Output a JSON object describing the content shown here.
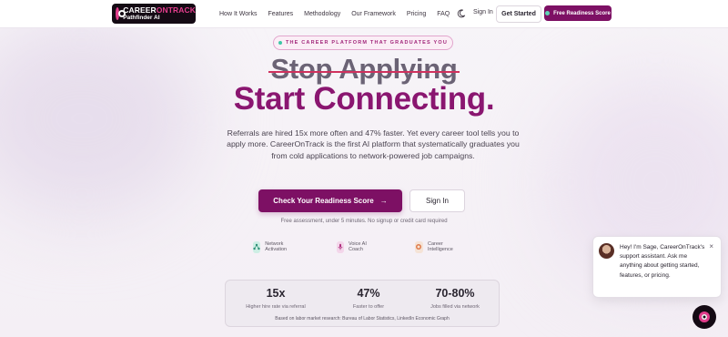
{
  "nav": {
    "logo_line1_a": "CAREER",
    "logo_line1_b": "ONTRACK",
    "logo_line2": "Pathfinder AI",
    "links": [
      "How It Works",
      "Features",
      "Methodology",
      "Our Framework",
      "Pricing",
      "FAQ"
    ],
    "signin": "Sign In",
    "get_started": "Get Started",
    "free_score": "Free Readiness Score"
  },
  "hero": {
    "badge": "THE CAREER PLATFORM THAT GRADUATES YOU",
    "strike_headline": "Stop Applying",
    "headline": "Start Connecting.",
    "subtitle": "Referrals are hired 15x more often and 47% faster. Yet every career tool tells you to apply more. CareerOnTrack is the first AI platform that systematically graduates you from cold applications to network-powered job campaigns.",
    "cta_primary": "Check Your Readiness Score",
    "cta_primary_arrow": "→",
    "cta_secondary": "Sign In",
    "note": "Free assessment, under 5 minutes. No signup or credit card required"
  },
  "features": [
    {
      "label": "Network Activation",
      "icon": "network-icon",
      "color": "#cdeee4"
    },
    {
      "label": "Voice AI Coach",
      "icon": "microphone-icon",
      "color": "#f3d6ea"
    },
    {
      "label": "Career Intelligence",
      "icon": "target-icon",
      "color": "#f5e3d6"
    }
  ],
  "stats": {
    "items": [
      {
        "value": "15x",
        "label": "Higher hire rate via referral"
      },
      {
        "value": "47%",
        "label": "Faster to offer"
      },
      {
        "value": "70-80%",
        "label": "Jobs filled via network"
      }
    ],
    "source": "Based on labor market research: Bureau of Labor Statistics, LinkedIn Economic Graph"
  },
  "chat": {
    "message": "Hey! I'm Sage, CareerOnTrack's support assistant. Ask me anything about getting started, features, or pricing.",
    "close": "×"
  },
  "colors": {
    "brand": "#7d1064",
    "headline": "#8a1670",
    "accent_pink": "#e23d8c",
    "strike": "#d0315e"
  }
}
